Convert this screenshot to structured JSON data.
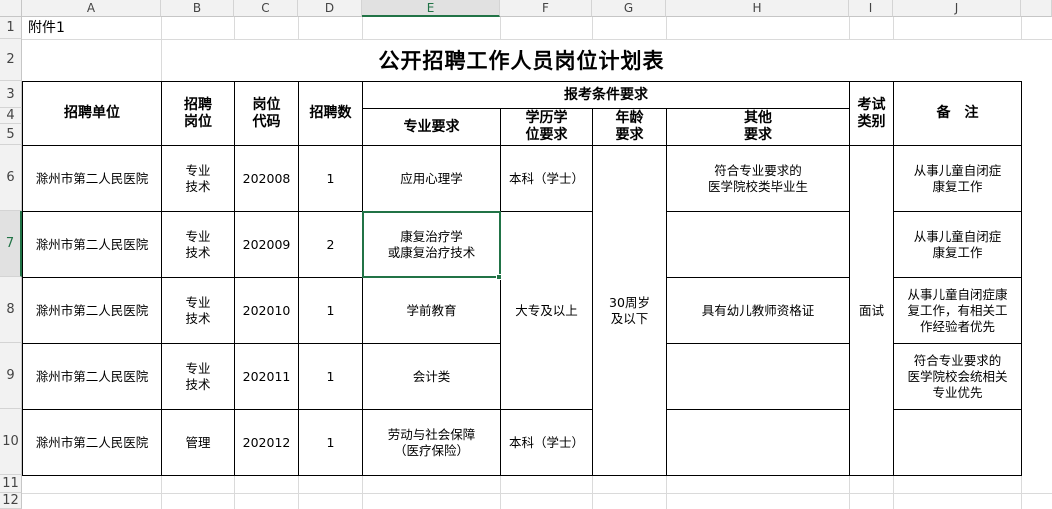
{
  "columns": [
    "A",
    "B",
    "C",
    "D",
    "E",
    "F",
    "G",
    "H",
    "I",
    "J"
  ],
  "rows": [
    "1",
    "2",
    "3",
    "4",
    "5",
    "6",
    "7",
    "8",
    "9",
    "10",
    "11",
    "12"
  ],
  "selected_cell": "E7",
  "sheet": {
    "a1": "附件1",
    "title": "公开招聘工作人员岗位计划表",
    "headers": {
      "unit": "招聘单位",
      "position": "招聘\n岗位",
      "code": "岗位\n代码",
      "count": "招聘数",
      "requirements": "报考条件要求",
      "major": "专业要求",
      "education": "学历学\n位要求",
      "age": "年龄\n要求",
      "other": "其他\n要求",
      "exam": "考试\n类别",
      "remark": "备　注"
    },
    "records": [
      {
        "unit": "滁州市第二人民医院",
        "position": "专业\n技术",
        "code": "202008",
        "count": "1",
        "major": "应用心理学",
        "education": "本科（学士）",
        "other": "符合专业要求的\n医学院校类毕业生",
        "remark": "从事儿童自闭症\n康复工作"
      },
      {
        "unit": "滁州市第二人民医院",
        "position": "专业\n技术",
        "code": "202009",
        "count": "2",
        "major": "康复治疗学\n或康复治疗技术",
        "remark": "从事儿童自闭症\n康复工作"
      },
      {
        "unit": "滁州市第二人民医院",
        "position": "专业\n技术",
        "code": "202010",
        "count": "1",
        "major": "学前教育",
        "other": "具有幼儿教师资格证",
        "remark": "从事儿童自闭症康\n复工作，有相关工\n作经验者优先"
      },
      {
        "unit": "滁州市第二人民医院",
        "position": "专业\n技术",
        "code": "202011",
        "count": "1",
        "major": "会计类",
        "remark": "符合专业要求的\n医学院校会统相关\n专业优先"
      },
      {
        "unit": "滁州市第二人民医院",
        "position": "管理",
        "code": "202012",
        "count": "1",
        "major": "劳动与社会保障\n（医疗保险）",
        "education": "本科（学士）"
      }
    ],
    "merged": {
      "education_mid": "大专及以上",
      "age": "30周岁\n及以下",
      "exam": "面试"
    }
  }
}
